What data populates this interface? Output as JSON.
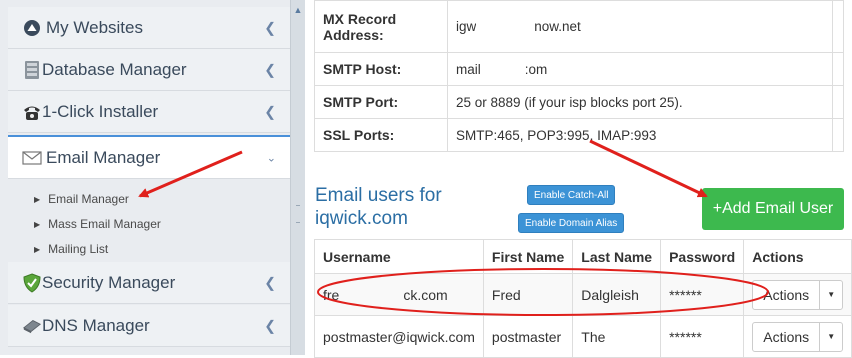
{
  "sidebar": {
    "items": [
      {
        "label": "My Websites",
        "icon": "dashboard-icon"
      },
      {
        "label": "Database Manager",
        "icon": "database-icon"
      },
      {
        "label": "1-Click Installer",
        "icon": "phone-icon"
      },
      {
        "label": "Email Manager",
        "icon": "envelope-icon"
      },
      {
        "label": "Security Manager",
        "icon": "shield-icon"
      },
      {
        "label": "DNS Manager",
        "icon": "server-icon"
      }
    ],
    "email_submenu": [
      "Email Manager",
      "Mass Email Manager",
      "Mailing List"
    ]
  },
  "info": {
    "rows": [
      {
        "key": "MX Record Address:",
        "value_start": "igw",
        "value_end": "now.net"
      },
      {
        "key": "SMTP Host:",
        "value_start": "mail",
        "value_end": ":om"
      },
      {
        "key": "SMTP Port:",
        "value": "25 or 8889 (if your isp blocks port 25)."
      },
      {
        "key": "SSL Ports:",
        "value": "SMTP:465, POP3:995, IMAP:993"
      }
    ]
  },
  "email_users": {
    "title": "Email users for iqwick.com",
    "enable_catch_all": "Enable Catch-All",
    "enable_domain_alias": "Enable Domain Alias",
    "add_button": "+Add Email User",
    "columns": [
      "Username",
      "First Name",
      "Last Name",
      "Password",
      "Actions"
    ],
    "rows": [
      {
        "username_start": "fre",
        "username_end": "ck.com",
        "first": "Fred",
        "last": "Dalgleish",
        "password": "******",
        "action": "Actions"
      },
      {
        "username": "postmaster@iqwick.com",
        "first": "postmaster",
        "last": "The",
        "password": "******",
        "action": "Actions"
      }
    ]
  },
  "colors": {
    "accent": "#2b6ea4",
    "add_button": "#3db94e",
    "small_buttons": "#3c93d6",
    "annotation": "#e0201c"
  }
}
